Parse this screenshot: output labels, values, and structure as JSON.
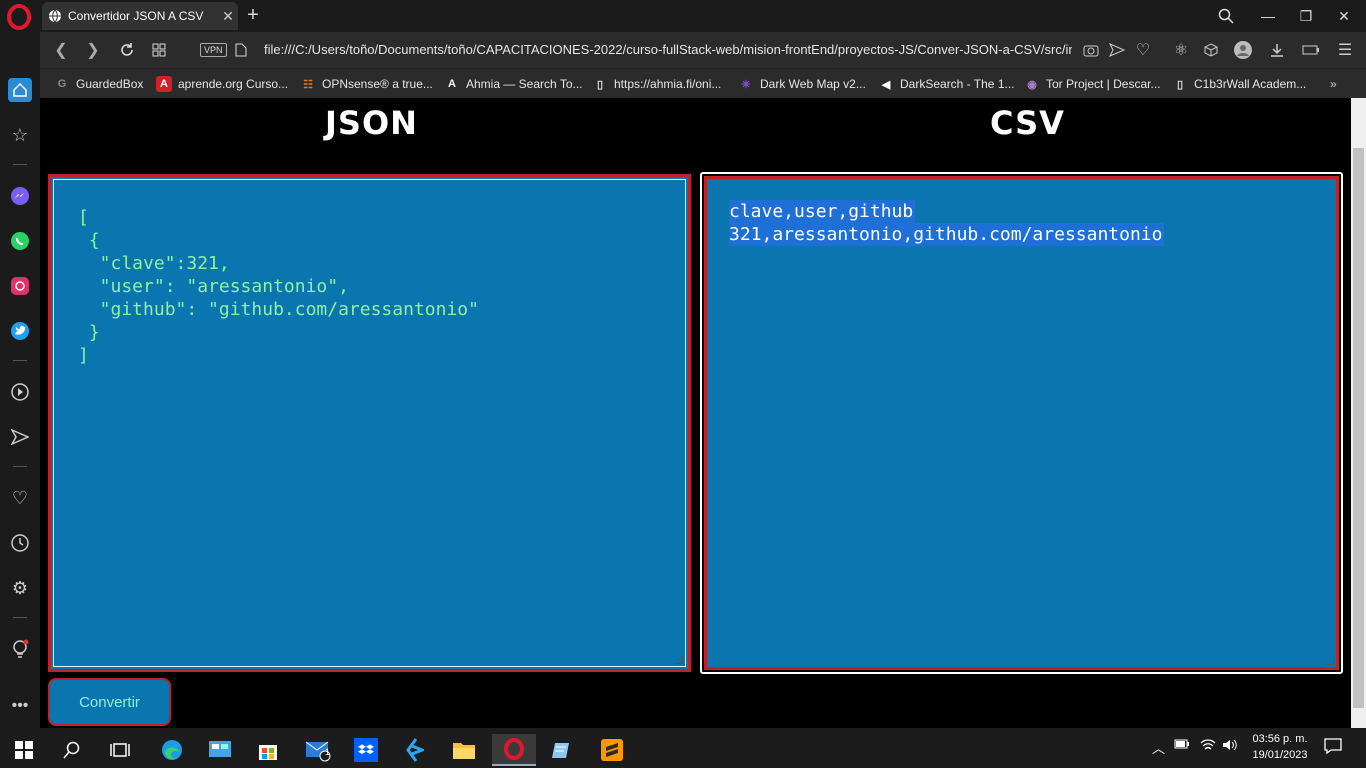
{
  "browser": {
    "tab_title": "Convertidor JSON A CSV",
    "url": "file:///C:/Users/toño/Documents/toño/CAPACITACIONES-2022/curso-fullStack-web/mision-frontEnd/proyectos-JS/Conver-JSON-a-CSV/src/in",
    "vpn_label": "VPN"
  },
  "bookmarks": [
    {
      "label": "GuardedBox",
      "icon": "guardedbox-icon"
    },
    {
      "label": "aprende.org Curso...",
      "icon": "aprende-icon"
    },
    {
      "label": "OPNsense® a true...",
      "icon": "opnsense-icon"
    },
    {
      "label": "Ahmia — Search To...",
      "icon": "ahmia-icon"
    },
    {
      "label": "https://ahmia.fi/oni...",
      "icon": "page-icon"
    },
    {
      "label": "Dark Web Map v2...",
      "icon": "darkwebmap-icon"
    },
    {
      "label": "DarkSearch - The 1...",
      "icon": "darksearch-icon"
    },
    {
      "label": "Tor Project | Descar...",
      "icon": "tor-icon"
    },
    {
      "label": "C1b3rWall Academ...",
      "icon": "page-icon"
    }
  ],
  "page": {
    "json_heading": "JSON",
    "csv_heading": "CSV",
    "json_lines": [
      "[",
      " {",
      "  \"clave\":321,",
      "  \"user\": \"aressantonio\",",
      "  \"github\": \"github.com/aressantonio\"",
      " }",
      "]"
    ],
    "csv_lines": [
      "clave,user,github ",
      "321,aressantonio,github.com/aressantonio"
    ],
    "convert_button": "Convertir"
  },
  "taskbar": {
    "time": "03:56 p. m.",
    "date": "19/01/2023",
    "mail_badge": "1"
  },
  "colors": {
    "panel_bg": "#0b75b0",
    "panel_border": "#c0222a",
    "json_text": "#8ef0a0",
    "selection": "#1e6fd6"
  }
}
